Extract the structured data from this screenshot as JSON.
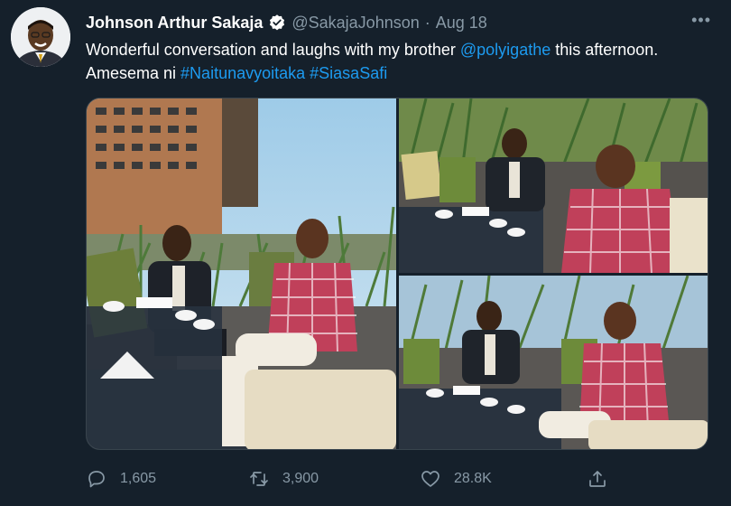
{
  "author": {
    "name": "Johnson Arthur Sakaja",
    "handle": "@SakajaJohnson",
    "separator": "·",
    "date": "Aug 18",
    "verified": true
  },
  "tweet": {
    "text_before_mention": "Wonderful conversation and laughs with my brother ",
    "mention": "@polyigathe",
    "text_after_mention": " this afternoon. Amesema ni ",
    "hashtag1": "#Naitunavyoitaka",
    "space": " ",
    "hashtag2": "#SiasaSafi"
  },
  "menu": {
    "more_label": "•••"
  },
  "media": {
    "photos": [
      {
        "name": "meeting-photo-left"
      },
      {
        "name": "meeting-photo-top-right"
      },
      {
        "name": "meeting-photo-bottom-right"
      }
    ]
  },
  "actions": {
    "replies": "1,605",
    "retweets": "3,900",
    "likes": "28.8K"
  },
  "colors": {
    "background": "#15202b",
    "link": "#1d9bf0",
    "muted": "#8899a6",
    "verified_badge": "#ffffff"
  }
}
